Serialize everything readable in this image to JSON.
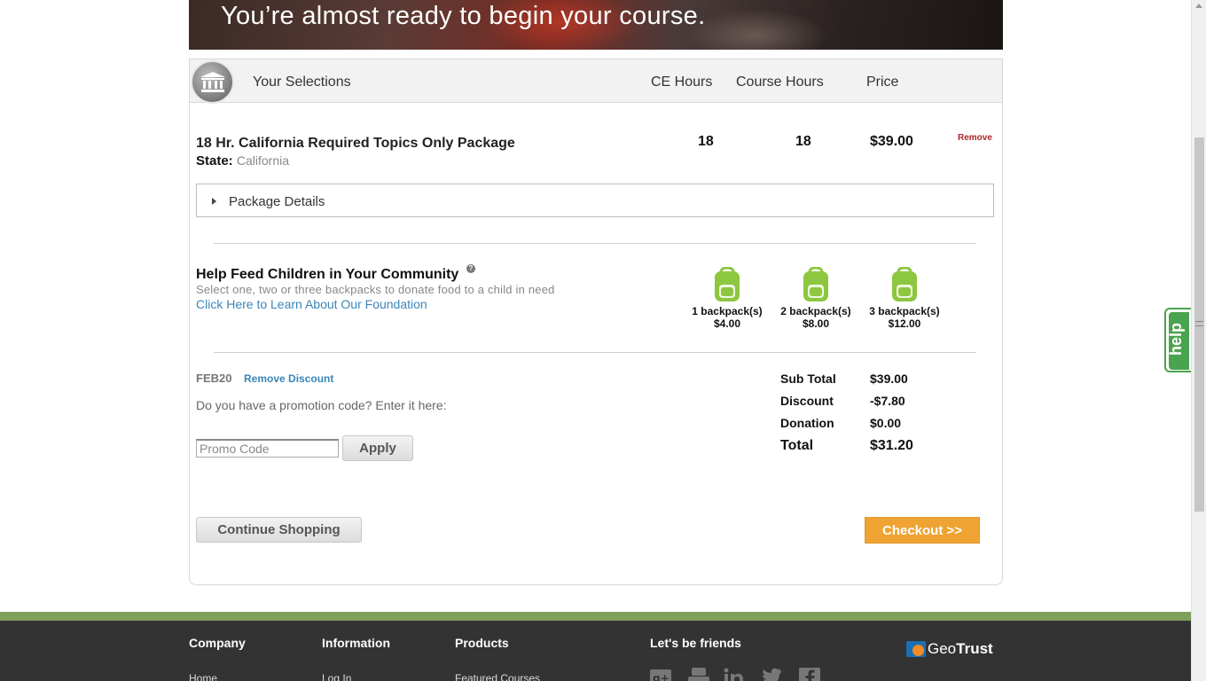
{
  "hero": {
    "text": "You’re almost ready to begin your course."
  },
  "selections": {
    "header": {
      "title": "Your Selections",
      "ce_hours": "CE Hours",
      "course_hours": "Course Hours",
      "price": "Price"
    },
    "item": {
      "name": "18 Hr. California Required Topics Only Package",
      "state_label": "State:",
      "state_value": "California",
      "ce_hours": "18",
      "course_hours": "18",
      "price": "$39.00",
      "remove_label": "Remove"
    },
    "package_details": "Package Details"
  },
  "donation": {
    "title": "Help Feed Children in Your Community",
    "help_icon": "?",
    "subtitle": "Select one, two or three backpacks to donate food to a child in need",
    "link": "Click Here to Learn About Our Foundation",
    "options": [
      {
        "label": "1 backpack(s)",
        "price": "$4.00"
      },
      {
        "label": "2 backpack(s)",
        "price": "$8.00"
      },
      {
        "label": "3 backpack(s)",
        "price": "$12.00"
      }
    ],
    "icon_color": "#8dc63f"
  },
  "promo": {
    "applied_code": "FEB20",
    "remove_label": "Remove Discount",
    "question": "Do you have a promotion code? Enter it here:",
    "placeholder": "Promo Code",
    "apply_label": "Apply"
  },
  "summary": {
    "subtotal_label": "Sub Total",
    "subtotal": "$39.00",
    "discount_label": "Discount",
    "discount": "-$7.80",
    "donation_label": "Donation",
    "donation": "$0.00",
    "total_label": "Total",
    "total": "$31.20"
  },
  "actions": {
    "continue": "Continue Shopping",
    "checkout": "Checkout >>"
  },
  "footer": {
    "columns": [
      {
        "title": "Company",
        "first_link": "Home"
      },
      {
        "title": "Information",
        "first_link": "Log In"
      },
      {
        "title": "Products",
        "first_link": "Featured Courses"
      }
    ],
    "social_title": "Let's be friends",
    "social_icons": [
      "google-plus-icon",
      "youtube-icon",
      "linkedin-icon",
      "twitter-icon",
      "facebook-icon"
    ],
    "geotrust_a": "Geo",
    "geotrust_b": "Trust"
  },
  "help_tab": "help",
  "colors": {
    "checkout": "#eea332",
    "link": "#3a86b8",
    "remove": "#b0242a",
    "footer": "#333333",
    "footer_stripe": "#7fa05a",
    "help": "#4aa34e"
  }
}
